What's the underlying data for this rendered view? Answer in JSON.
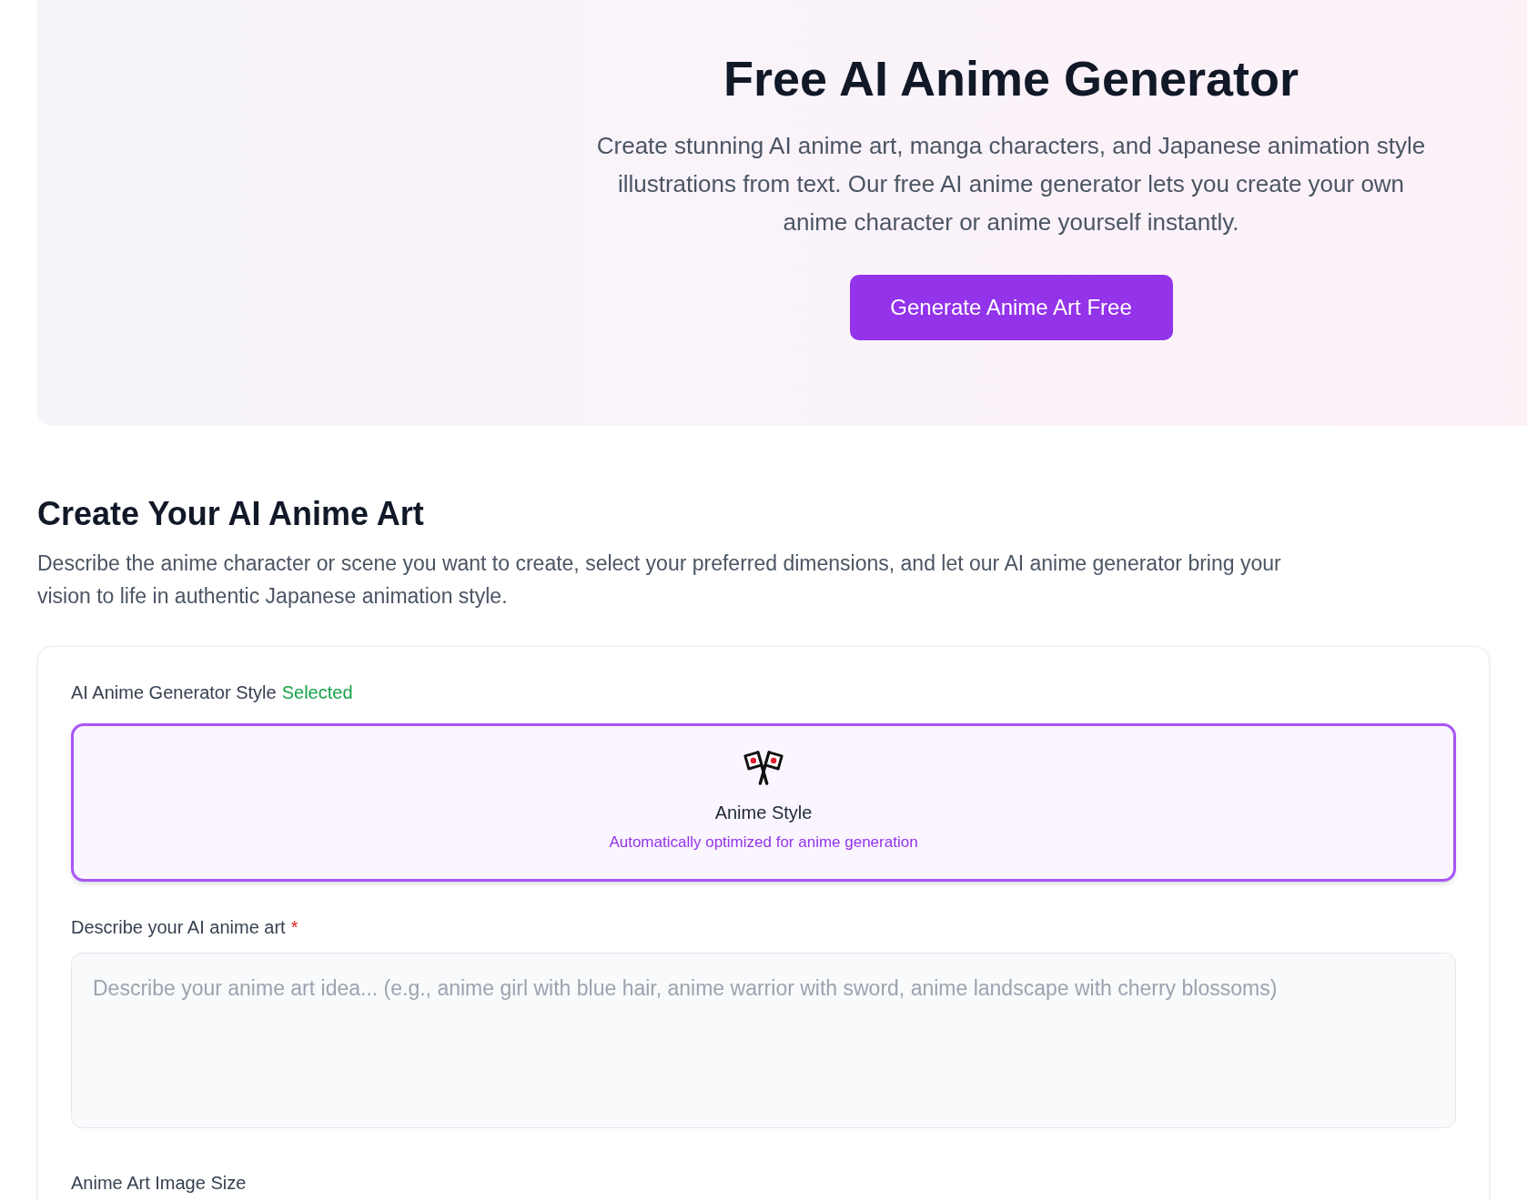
{
  "hero": {
    "title": "Free AI Anime Generator",
    "description": "Create stunning AI anime art, manga characters, and Japanese animation style illustrations from text. Our free AI anime generator lets you create your own anime character or anime yourself instantly.",
    "cta_button": "Generate Anime Art Free"
  },
  "create_section": {
    "heading": "Create Your AI Anime Art",
    "description": "Describe the anime character or scene you want to create, select your preferred dimensions, and let our AI anime generator bring your vision to life in authentic Japanese animation style."
  },
  "form": {
    "style_label": "AI Anime Generator Style",
    "style_status": "Selected",
    "style_options": [
      {
        "name": "Anime Style",
        "description": "Automatically optimized for anime generation",
        "selected": true
      }
    ],
    "prompt": {
      "label": "Describe your AI anime art",
      "required_mark": "*",
      "placeholder": "Describe your anime art idea... (e.g., anime girl with blue hair, anime warrior with sword, anime landscape with cherry blossoms)"
    },
    "size_label": "Anime Art Image Size"
  }
}
